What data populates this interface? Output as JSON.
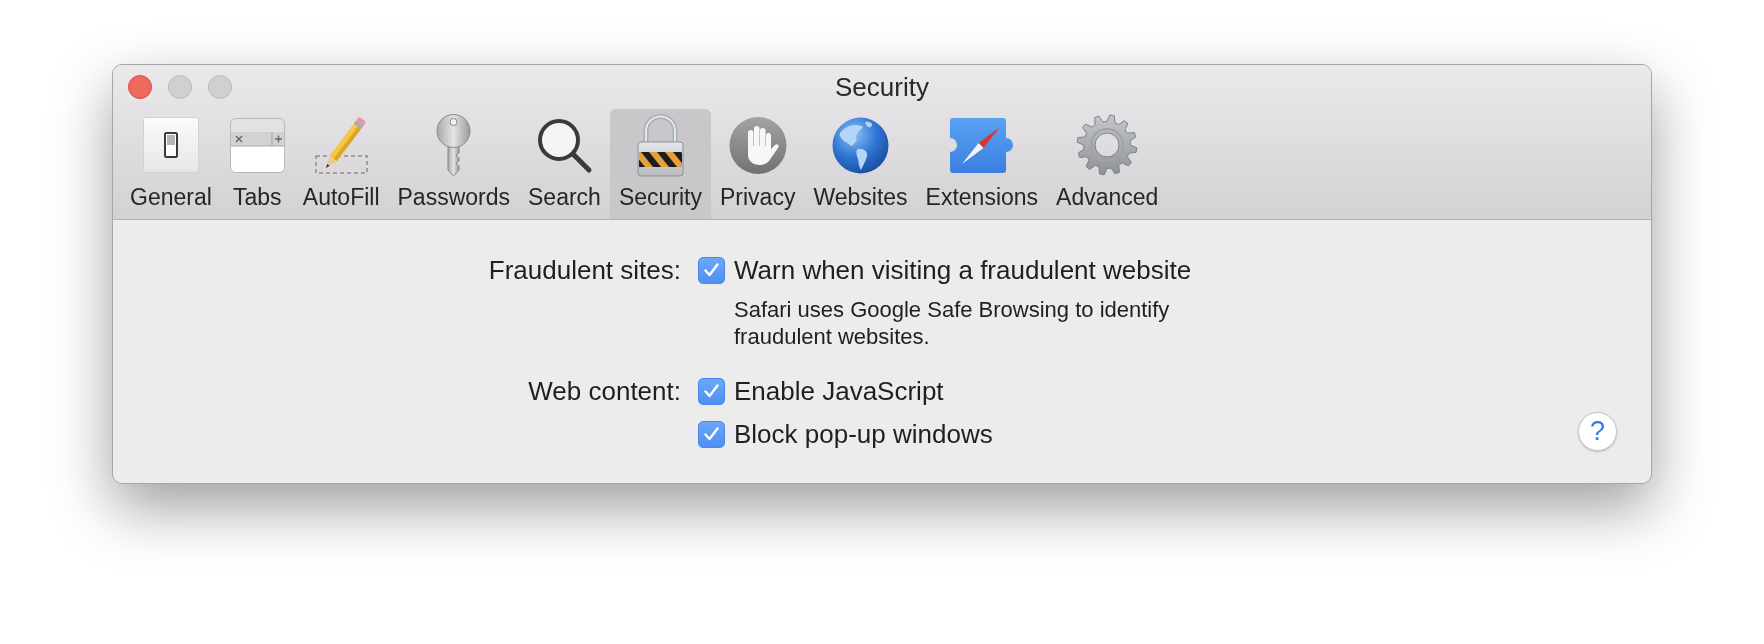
{
  "window": {
    "title": "Security",
    "buttons": [
      {
        "kind": "close",
        "active": true
      },
      {
        "kind": "minimize",
        "active": false
      },
      {
        "kind": "zoom",
        "active": false
      }
    ]
  },
  "toolbar": {
    "tabs": [
      {
        "label": "General",
        "kind": "switch",
        "selected": false
      },
      {
        "label": "Tabs",
        "kind": "tabs",
        "selected": false
      },
      {
        "label": "AutoFill",
        "kind": "pencil",
        "selected": false
      },
      {
        "label": "Passwords",
        "kind": "key",
        "selected": false
      },
      {
        "label": "Search",
        "kind": "magnifier",
        "selected": false
      },
      {
        "label": "Security",
        "kind": "padlock",
        "selected": true
      },
      {
        "label": "Privacy",
        "kind": "hand",
        "selected": false
      },
      {
        "label": "Websites",
        "kind": "globe",
        "selected": false
      },
      {
        "label": "Extensions",
        "kind": "puzzle",
        "selected": false
      },
      {
        "label": "Advanced",
        "kind": "gear",
        "selected": false
      }
    ]
  },
  "settings": [
    {
      "label": "Fraudulent sites:",
      "options": [
        {
          "text": "Warn when visiting a fraudulent website",
          "checked": true,
          "note": "Safari uses Google Safe Browsing to identify fraudulent websites."
        }
      ]
    },
    {
      "label": "Web content:",
      "options": [
        {
          "text": "Enable JavaScript",
          "checked": true
        },
        {
          "text": "Block pop-up windows",
          "checked": true
        }
      ]
    }
  ],
  "help_button": {
    "label": "?"
  }
}
